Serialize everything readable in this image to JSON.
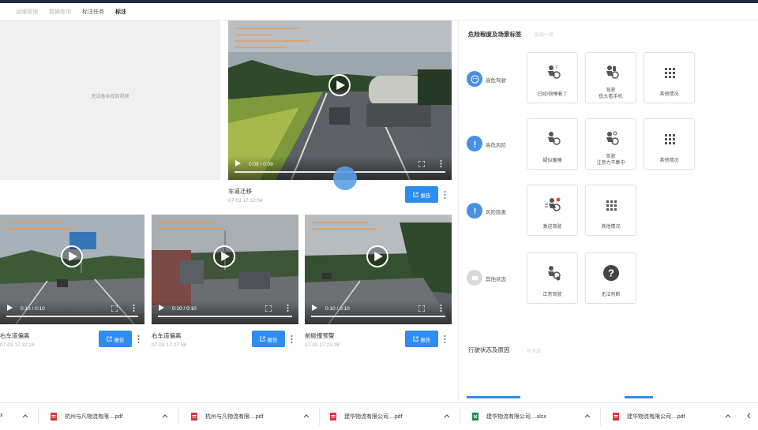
{
  "nav": {
    "tabs": [
      {
        "label": "运维管理",
        "state": "faded"
      },
      {
        "label": "数据查询",
        "state": "faded"
      },
      {
        "label": "标注任务",
        "state": "dark"
      },
      {
        "label": "标注",
        "state": "active"
      }
    ]
  },
  "left": {
    "placeholder_text": "无设备未找到视频",
    "videos": [
      {
        "title": "车道迁移",
        "time": "07-03 17:32:04",
        "video_time": "0:09 / 0:09",
        "report_label": "报告"
      },
      {
        "title": "右车道偏离",
        "time": "07-03 17:32:24",
        "video_time": "0:10 / 0:10",
        "report_label": "报告"
      },
      {
        "title": "右车道偏离",
        "time": "07-03 17:27:58",
        "video_time": "0:10 / 0:10",
        "report_label": "报告"
      },
      {
        "title": "前碰撞预警",
        "time": "07-03 17:23:28",
        "video_time": "0:10 / 0:10",
        "report_label": "报告"
      }
    ]
  },
  "right": {
    "title": "危险程度及场景标签",
    "subtitle": "选择一项",
    "categories": [
      {
        "label": "高危驾驶",
        "color": "#4a90e2",
        "icon": "face-icon",
        "options": [
          {
            "label": "已经/快睡着了",
            "icon": "sleeping-driver-icon"
          },
          {
            "label": "驾驶\n低头看手机",
            "icon": "phone-driver-icon"
          },
          {
            "label": "其他情况",
            "icon": "grid-icon"
          }
        ]
      },
      {
        "label": "高危风险",
        "color": "#4a90e2",
        "icon": "alert-icon",
        "options": [
          {
            "label": "疑似瞌睡",
            "icon": "drowsy-driver-icon"
          },
          {
            "label": "驾驶\n注意力不集中",
            "icon": "distracted-driver-icon"
          },
          {
            "label": "其他情况",
            "icon": "grid-icon"
          }
        ]
      },
      {
        "label": "风险隐患",
        "color": "#4a90e2",
        "icon": "warning-icon",
        "options": [
          {
            "label": "激进驾驶",
            "icon": "aggressive-driving-icon"
          },
          {
            "label": "其他情况",
            "icon": "grid-icon"
          }
        ]
      },
      {
        "label": "其他状态",
        "color": "#d8d8d8",
        "icon": "misc-icon",
        "options": [
          {
            "label": "正常驾驶",
            "icon": "normal-driver-icon"
          },
          {
            "label": "无法判断",
            "icon": "question-icon"
          }
        ]
      }
    ],
    "section2_title": "行驶状态及原因",
    "section2_sub": "可多选"
  },
  "downloads": [
    {
      "name": "杭州与凡物流有限....pdf",
      "type": "pdf"
    },
    {
      "name": "杭州与凡物流有限....pdf",
      "type": "pdf"
    },
    {
      "name": "建华物流有限公司....pdf",
      "type": "pdf"
    },
    {
      "name": "建华物流有限公司....xlsx",
      "type": "xlsx"
    },
    {
      "name": "建华物流有限公司....pdf",
      "type": "pdf"
    }
  ],
  "colors": {
    "accent": "#2f8cf0",
    "pdf": "#d9363e",
    "xlsx": "#1f8f4e",
    "header": "#1e2a44"
  }
}
